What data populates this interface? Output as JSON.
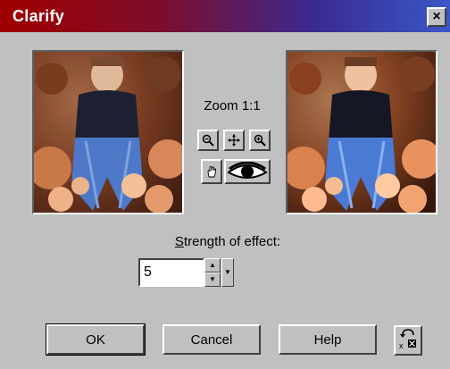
{
  "window": {
    "title": "Clarify",
    "close_glyph": "×"
  },
  "zoom": {
    "label": "Zoom 1:1",
    "zoom_out_icon": "zoom-out-icon",
    "pan_icon": "move-icon",
    "zoom_in_icon": "zoom-in-icon",
    "hand_icon": "hand-icon",
    "proof_icon": "eye-icon"
  },
  "strength": {
    "label_accesskey": "S",
    "label_rest": "trength of effect:",
    "value": "5"
  },
  "buttons": {
    "ok": "OK",
    "cancel": "Cancel",
    "help": "Help",
    "reset_icon": "reset-icon"
  },
  "colors": {
    "dialog_bg": "#c0c0c0",
    "title_start": "#a00000",
    "title_end": "#3a57c8"
  }
}
